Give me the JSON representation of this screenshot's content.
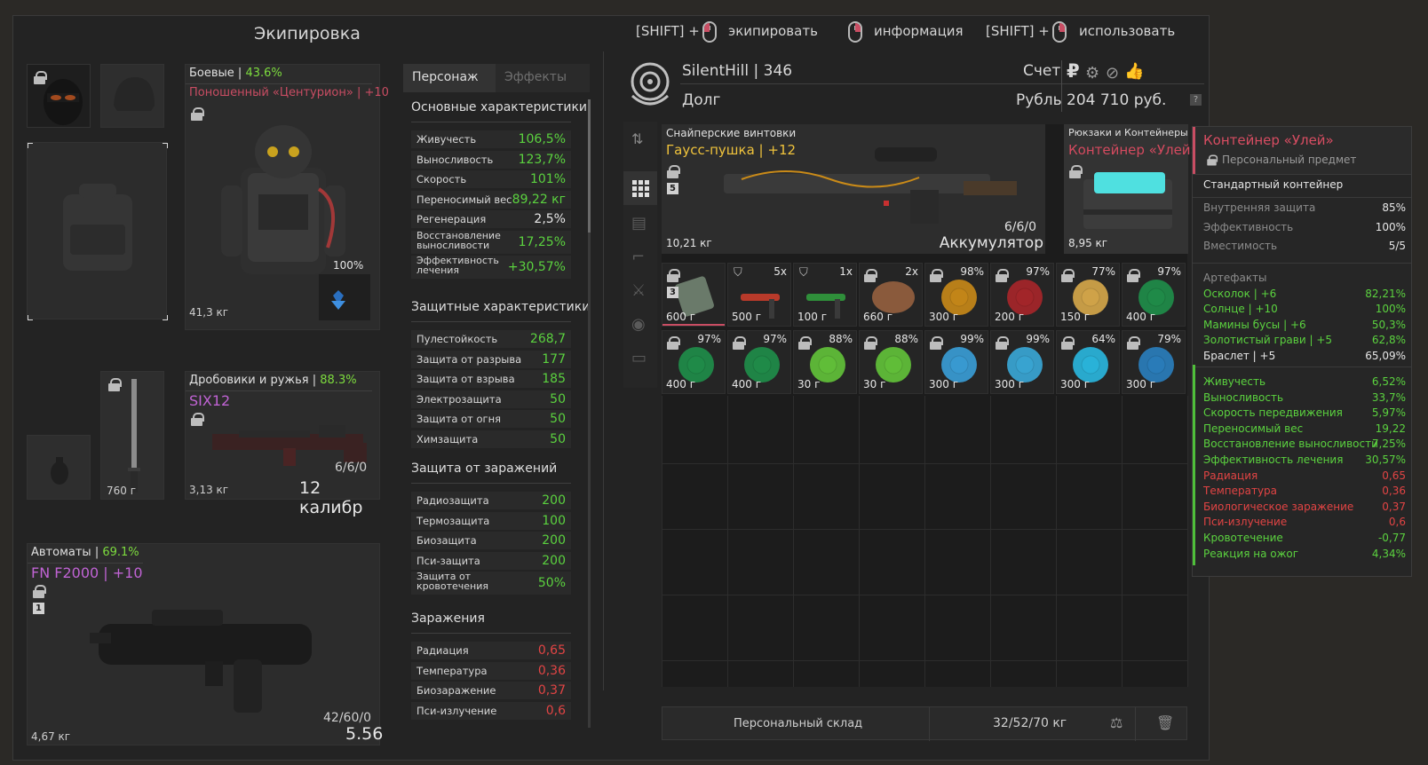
{
  "equipment": {
    "title": "Экипировка",
    "armor": {
      "category": "Боевые",
      "percent": "43.6%",
      "name": "Поношенный «Центурион» | +10",
      "durability": "100%",
      "weight": "41,3 кг"
    },
    "melee": {
      "weight": "760 г"
    },
    "shotgun": {
      "category": "Дробовики и ружья",
      "percent": "88.3%",
      "name": "SIX12",
      "ammo": "6/6/0",
      "caliber": "12 калибр",
      "weight": "3,13 кг"
    },
    "rifle": {
      "category": "Автоматы",
      "percent": "69.1%",
      "name": "FN F2000 | +10",
      "slot_number": "1",
      "ammo": "42/60/0",
      "caliber": "5.56",
      "weight": "4,67 кг"
    }
  },
  "stats": {
    "tabs": [
      "Персонаж",
      "Эффекты"
    ],
    "sections": {
      "main": {
        "title": "Основные характеристики",
        "rows": [
          {
            "label": "Живучесть",
            "value": "106,5%"
          },
          {
            "label": "Выносливость",
            "value": "123,7%"
          },
          {
            "label": "Скорость",
            "value": "101%"
          },
          {
            "label": "Переносимый вес",
            "value": "89,22 кг"
          },
          {
            "label": "Регенерация",
            "value": "2,5%"
          },
          {
            "label": "Восстановление выносливости",
            "value": "17,25%"
          },
          {
            "label": "Эффективность лечения",
            "value": "+30,57%"
          }
        ]
      },
      "protect": {
        "title": "Защитные характеристики",
        "rows": [
          {
            "label": "Пулестойкость",
            "value": "268,7"
          },
          {
            "label": "Защита от разрыва",
            "value": "177"
          },
          {
            "label": "Защита от взрыва",
            "value": "185"
          },
          {
            "label": "Электрозащита",
            "value": "50"
          },
          {
            "label": "Защита от огня",
            "value": "50"
          },
          {
            "label": "Химзащита",
            "value": "50"
          }
        ]
      },
      "infection": {
        "title": "Защита от заражений",
        "rows": [
          {
            "label": "Радиозащита",
            "value": "200"
          },
          {
            "label": "Термозащита",
            "value": "100"
          },
          {
            "label": "Биозащита",
            "value": "200"
          },
          {
            "label": "Пси-защита",
            "value": "200"
          },
          {
            "label": "Защита от кровотечения",
            "value": "50%"
          }
        ]
      },
      "contam": {
        "title": "Заражения",
        "rows": [
          {
            "label": "Радиация",
            "value": "0,65"
          },
          {
            "label": "Температура",
            "value": "0,36"
          },
          {
            "label": "Биозаражение",
            "value": "0,37"
          },
          {
            "label": "Пси-излучение",
            "value": "0,6"
          }
        ]
      }
    }
  },
  "hints": {
    "shift1": "[SHIFT] +",
    "equip": "экипировать",
    "info": "информация",
    "shift2": "[SHIFT] +",
    "use": "использовать"
  },
  "account": {
    "player": "SilentHill | 346",
    "account_label": "Счет",
    "debt_label": "Долг",
    "currency_label": "Рубль",
    "balance": "204 710 руб.",
    "currency_symbol": "₽",
    "help": "?"
  },
  "inventory": {
    "gauss": {
      "category": "Снайперские винтовки",
      "name": "Гаусс-пушка | +12",
      "slot_number": "5",
      "ammo": "6/6/0",
      "ammo_type": "Аккумулятор",
      "weight": "10,21 кг"
    },
    "container": {
      "category": "Рюкзаки и Контейнеры",
      "name": "Контейнер «Улей»",
      "weight": "8,95 кг"
    },
    "row1": [
      {
        "w": "600 г",
        "p": "",
        "badge": "3",
        "lock": true,
        "icon": "device-icon",
        "color": "#6a7a6a"
      },
      {
        "w": "500 г",
        "p": "5x",
        "lock": false,
        "shield": true,
        "icon": "injector-icon",
        "color": "#b83a2a"
      },
      {
        "w": "100 г",
        "p": "1x",
        "lock": false,
        "shield": true,
        "icon": "injector-icon",
        "color": "#2f8f3a"
      },
      {
        "w": "660 г",
        "p": "2x",
        "lock": true,
        "icon": "meat-icon",
        "color": "#8a5a3c"
      },
      {
        "w": "300 г",
        "p": "98%",
        "lock": true,
        "icon": "artifact-icon",
        "color": "#c98a18"
      },
      {
        "w": "200 г",
        "p": "97%",
        "lock": true,
        "icon": "artifact-icon",
        "color": "#a8262a"
      },
      {
        "w": "150 г",
        "p": "77%",
        "lock": true,
        "icon": "artifact-icon",
        "color": "#d7a84a"
      },
      {
        "w": "400 г",
        "p": "97%",
        "lock": true,
        "icon": "artifact-icon",
        "color": "#1f8f4a"
      }
    ],
    "row2": [
      {
        "w": "400 г",
        "p": "97%",
        "lock": true,
        "icon": "artifact-icon",
        "color": "#1f8f4a"
      },
      {
        "w": "400 г",
        "p": "97%",
        "lock": true,
        "icon": "artifact-icon",
        "color": "#1f8f4a"
      },
      {
        "w": "30 г",
        "p": "88%",
        "lock": true,
        "icon": "artifact-icon",
        "color": "#63c43a"
      },
      {
        "w": "30 г",
        "p": "88%",
        "lock": true,
        "icon": "artifact-icon",
        "color": "#63c43a"
      },
      {
        "w": "300 г",
        "p": "99%",
        "lock": true,
        "icon": "artifact-icon",
        "color": "#3a9fd8"
      },
      {
        "w": "300 г",
        "p": "99%",
        "lock": true,
        "icon": "artifact-icon",
        "color": "#3aa9d8"
      },
      {
        "w": "300 г",
        "p": "64%",
        "lock": true,
        "icon": "artifact-icon",
        "color": "#2ab8e0"
      },
      {
        "w": "300 г",
        "p": "79%",
        "lock": true,
        "icon": "artifact-icon",
        "color": "#2a7fbf"
      }
    ],
    "storage_label": "Персональный склад",
    "storage_weight": "32/52/70 кг"
  },
  "tooltip": {
    "title": "Контейнер «Улей»",
    "subtitle": "Персональный предмет",
    "type": "Стандартный контейнер",
    "props": [
      {
        "label": "Внутренняя защита",
        "value": "85%"
      },
      {
        "label": "Эффективность",
        "value": "100%"
      },
      {
        "label": "Вместимость",
        "value": "5/5"
      }
    ],
    "artifacts_title": "Артефакты",
    "artifacts": [
      {
        "label": "Осколок | +6",
        "value": "82,21%"
      },
      {
        "label": "Солнце | +10",
        "value": "100%"
      },
      {
        "label": "Мамины бусы | +6",
        "value": "50,3%"
      },
      {
        "label": "Золотистый грави | +5",
        "value": "62,8%"
      },
      {
        "label": "Браслет | +5",
        "value": "65,09%"
      }
    ],
    "effects": [
      {
        "label": "Живучесть",
        "value": "6,52%",
        "c": "g"
      },
      {
        "label": "Выносливость",
        "value": "33,7%",
        "c": "g"
      },
      {
        "label": "Скорость передвижения",
        "value": "5,97%",
        "c": "g"
      },
      {
        "label": "Переносимый вес",
        "value": "19,22",
        "c": "g"
      },
      {
        "label": "Восстановление выносливости",
        "value": "7,25%",
        "c": "g"
      },
      {
        "label": "Эффективность лечения",
        "value": "30,57%",
        "c": "g"
      },
      {
        "label": "Радиация",
        "value": "0,65",
        "c": "r"
      },
      {
        "label": "Температура",
        "value": "0,36",
        "c": "r"
      },
      {
        "label": "Биологическое заражение",
        "value": "0,37",
        "c": "r"
      },
      {
        "label": "Пси-излучение",
        "value": "0,6",
        "c": "r"
      },
      {
        "label": "Кровотечение",
        "value": "-0,77",
        "c": "g"
      },
      {
        "label": "Реакция на ожог",
        "value": "4,34%",
        "c": "g"
      }
    ]
  },
  "colors": {
    "accent": "#c94d63",
    "positive": "#5bd23f",
    "negative": "#e24444",
    "weapon_name": "#f0c33c"
  }
}
